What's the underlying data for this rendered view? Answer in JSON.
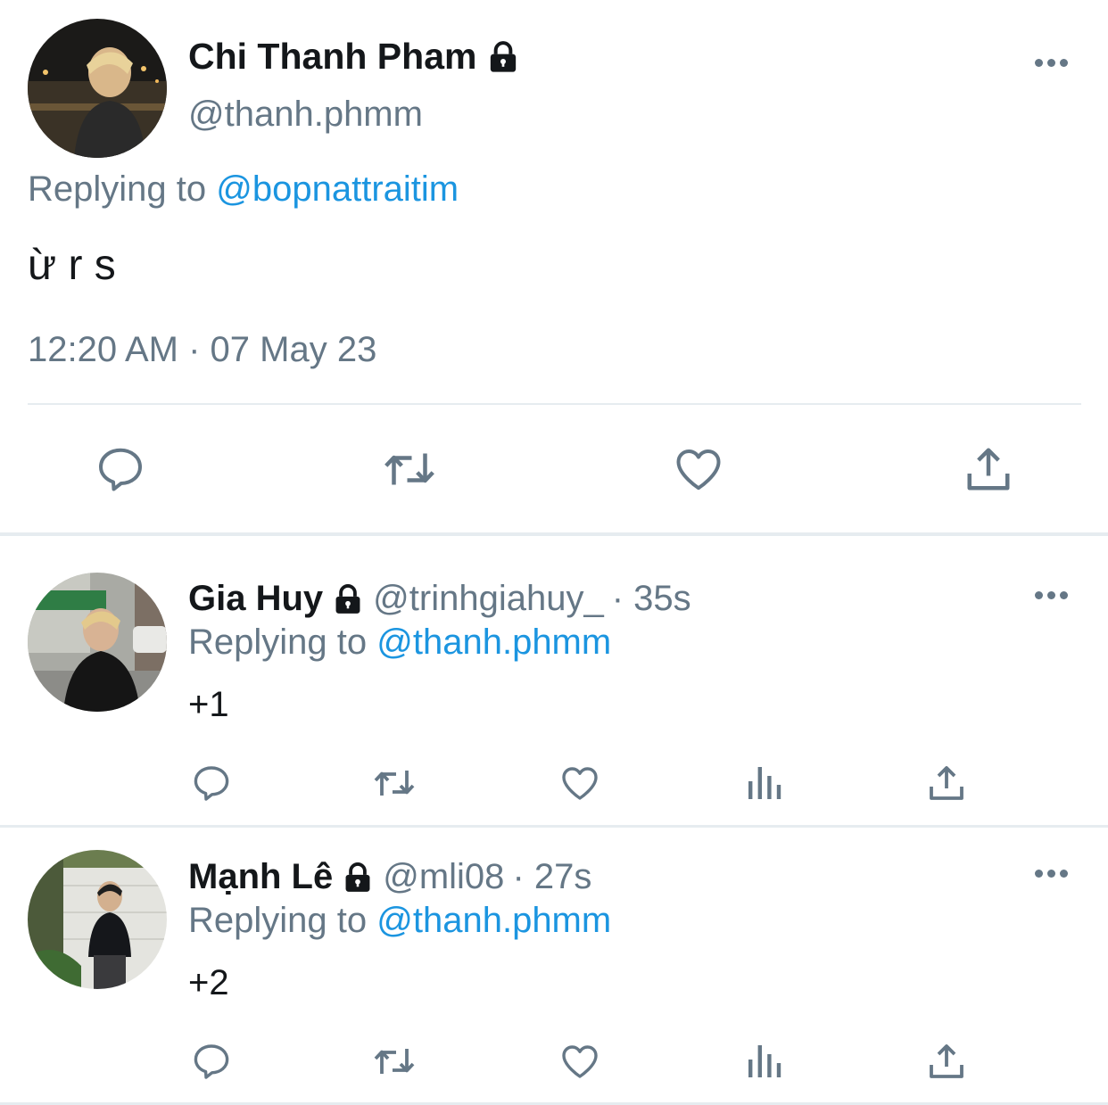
{
  "main_tweet": {
    "display_name": "Chi Thanh Pham",
    "handle": "@thanh.phmm",
    "replying_prefix": "Replying to",
    "replying_handle": "@bopnattraitim",
    "text": "ừ r s",
    "timestamp": "12:20 AM · 07 May 23"
  },
  "replies": [
    {
      "display_name": "Gia Huy",
      "handle": "@trinhgiahuy_",
      "time": "· 35s",
      "replying_prefix": "Replying to",
      "replying_handle": "@thanh.phmm",
      "text": "+1"
    },
    {
      "display_name": "Mạnh Lê",
      "handle": "@mli08",
      "time": "· 27s",
      "replying_prefix": "Replying to",
      "replying_handle": "@thanh.phmm",
      "text": "+2"
    }
  ],
  "icons": {
    "more": "more-icon",
    "lock": "lock-icon",
    "reply": "reply-icon",
    "retweet": "retweet-icon",
    "like": "like-icon",
    "analytics": "analytics-icon",
    "share": "share-icon"
  },
  "colors": {
    "link": "#1b95e0",
    "muted": "#657786",
    "text": "#14171a",
    "divider": "#e6ecf0"
  }
}
